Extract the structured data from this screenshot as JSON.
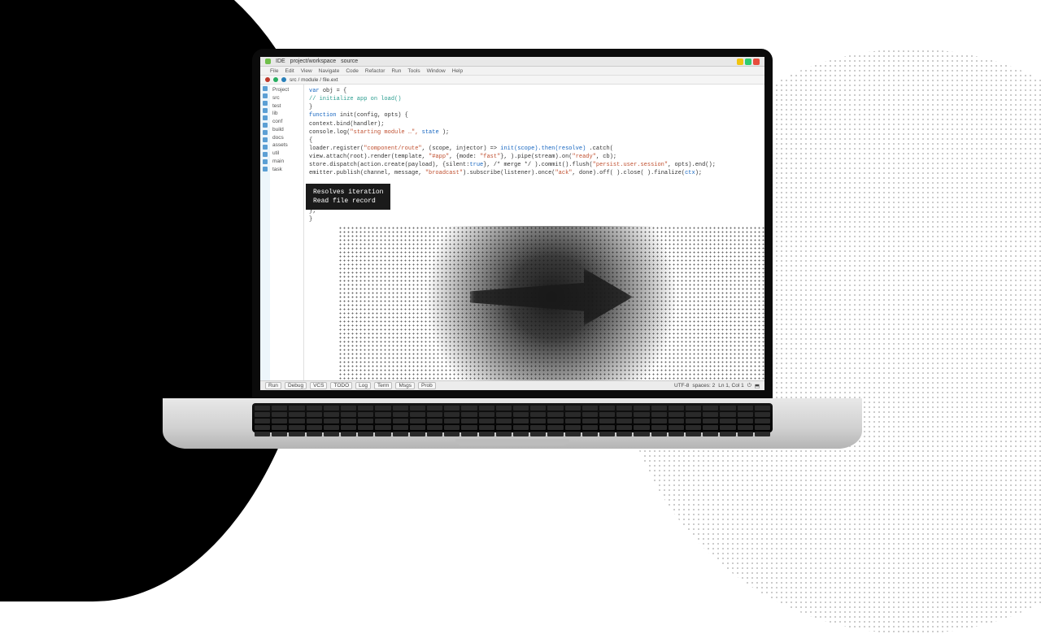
{
  "titlebar": {
    "app_label": "IDE",
    "project_label": "project/workspace",
    "active_file": "source"
  },
  "menu": {
    "items": [
      "File",
      "Edit",
      "View",
      "Navigate",
      "Code",
      "Refactor",
      "Run",
      "Tools",
      "Window",
      "Help"
    ]
  },
  "tabbar": {
    "path_hint": "src / module / file.ext"
  },
  "tree": {
    "items": [
      "Project",
      "  src",
      "  test",
      "  lib",
      "  conf",
      "  build",
      "  docs",
      "  assets",
      "  util",
      "  main",
      "  task"
    ]
  },
  "code": {
    "l1a": "var ",
    "l1b": "obj",
    "l1c": " = {",
    "l2": "  // initialize app on load()",
    "l3": "}",
    "l4a": "function ",
    "l4b": "init",
    "l4c": "(config, opts) {",
    "l5": "  context.bind(handler);",
    "l6a": "  console.log(",
    "l6b": "\"starting module …\", ",
    "l6c": "state",
    "l6d": " );",
    "l7": "  {",
    "l8a": "    loader.register(",
    "l8b": "\"component/route\"",
    "l8c": ",  (scope, injector)  => ",
    "l8d": "init(scope).then(resolve) ",
    "l8e": ".catch(",
    "l9a": "    view.attach(root).render(template, ",
    "l9b": "\"#app\"",
    "l9c": ", {mode: ",
    "l9d": "\"fast\"",
    "l9e": "}, ).pipe(stream).on(",
    "l9f": "\"ready\"",
    "l9g": ", cb);",
    "l10a": "    store.dispatch(action.create(payload), {silent:",
    "l10b": "true",
    "l10c": "}, /* merge */ ).commit().flush(",
    "l10d": "\"persist.user.session\"",
    "l10e": ", opts).end();",
    "l11a": "    emitter.publish(channel, message, ",
    "l11b": "\"broadcast\"",
    "l11c": ").subscribe(listener).once(",
    "l11d": "\"ack\"",
    "l11e": ", done).off( ).close( ).finalize(",
    "l11f": "ctx",
    "l11g": ");"
  },
  "tooltip": {
    "line1": "Resolves iteration",
    "line2": "Read file record"
  },
  "tail": {
    "l1": "  }",
    "l2": "};",
    "l3": "}"
  },
  "statusbar": {
    "left": [
      "Run",
      "Debug",
      "VCS",
      "TODO",
      "Log",
      "Term",
      "Msgs",
      "Prob"
    ],
    "right": [
      "UTF-8",
      "spaces: 2",
      "Ln 1, Col 1",
      "⏻",
      "⬒"
    ]
  }
}
